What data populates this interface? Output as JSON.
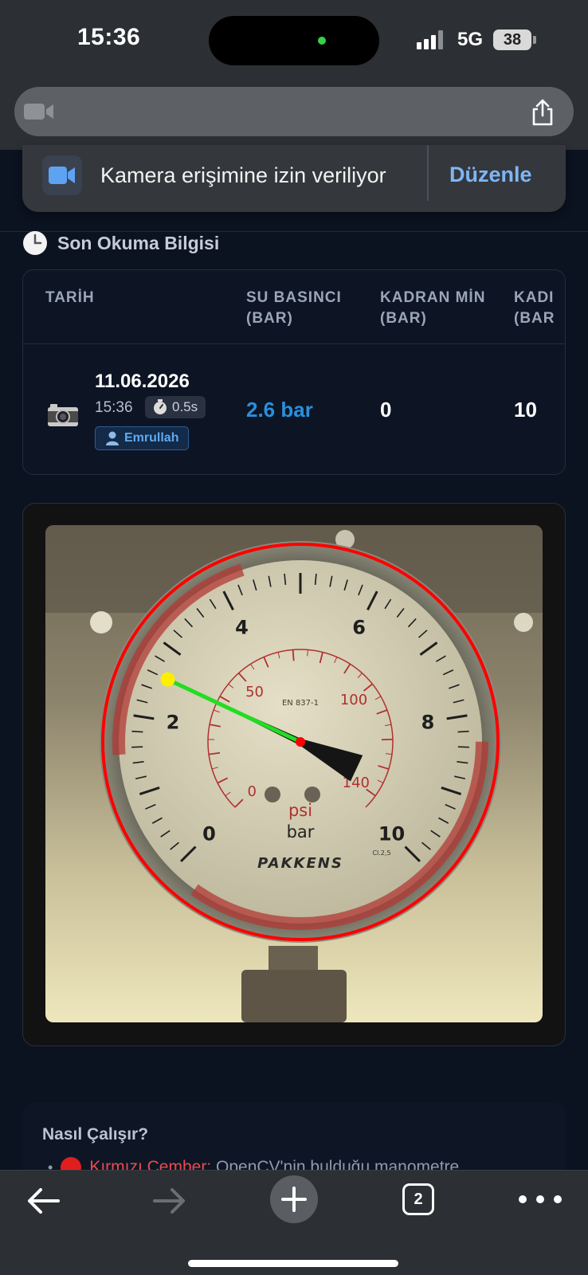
{
  "status_bar": {
    "time": "15:36",
    "network": "5G",
    "battery": "38"
  },
  "browser": {
    "url_placeholder": "",
    "tab_count": "2"
  },
  "permission_banner": {
    "message": "Kamera erişimine izin veriliyor",
    "edit_label": "Düzenle"
  },
  "last_reading": {
    "section_title": "Son Okuma Bilgisi",
    "columns": [
      {
        "line1": "TARİH",
        "line2": ""
      },
      {
        "line1": "SU BASINCI",
        "line2": "(BAR)"
      },
      {
        "line1": "KADRAN MİN",
        "line2": "(BAR)"
      },
      {
        "line1": "KADI",
        "line2": "(BAR"
      }
    ],
    "row": {
      "date": "11.06.2026",
      "time": "15:36",
      "duration": "0.5s",
      "user": "Emrullah",
      "pressure": "2.6 bar",
      "dial_min": "0",
      "dial_max": "10"
    }
  },
  "gauge_photo": {
    "brand": "PAKKENS",
    "standard": "EN 837-1",
    "class": "Cl.2,5",
    "outer_labels": [
      "0",
      "2",
      "4",
      "6",
      "8",
      "10"
    ],
    "outer_unit": "bar",
    "inner_labels": [
      "0",
      "50",
      "100",
      "140"
    ],
    "inner_unit": "psi",
    "needle_value_bar": 2.6,
    "detected_circle_color": "#ff0000",
    "needle_line_color": "#22dd22",
    "needle_tip_color": "#ffee00",
    "center_color": "#ff0000"
  },
  "how_it_works": {
    "title": "Nasıl Çalışır?",
    "item_key": "Kırmızı Çember:",
    "item_text": " OpenCV'nin bulduğu manometre"
  }
}
